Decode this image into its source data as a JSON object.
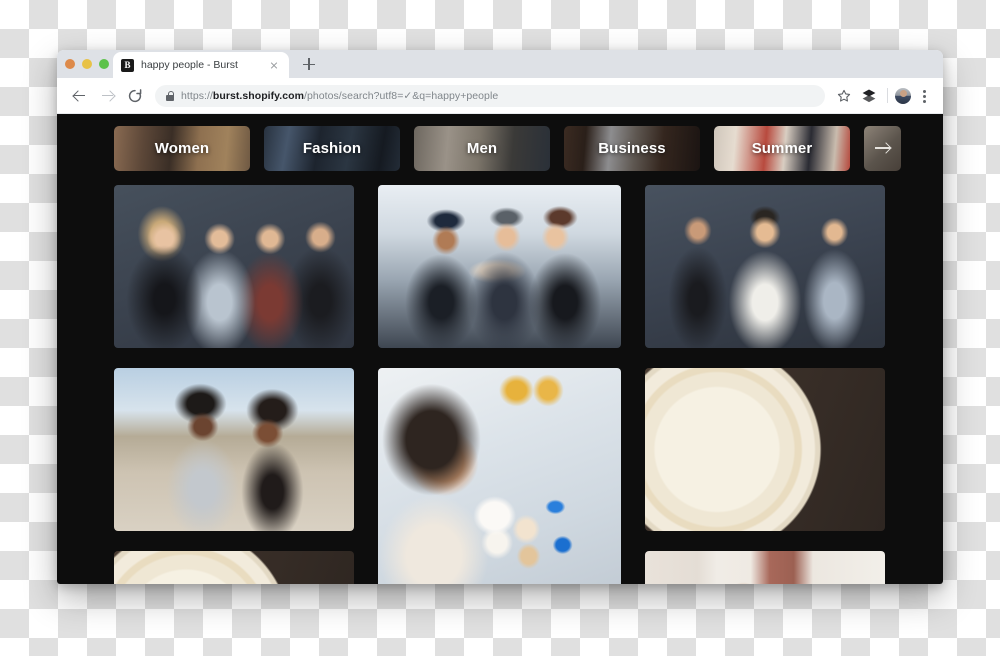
{
  "browser": {
    "window_controls": [
      "close",
      "minimize",
      "maximize"
    ],
    "tab": {
      "title": "happy people - Burst",
      "favicon_letter": "B",
      "close_label": "×"
    },
    "new_tab_label": "+",
    "nav": {
      "back_icon": "back-arrow-icon",
      "forward_icon": "forward-arrow-icon",
      "reload_icon": "reload-icon"
    },
    "address_bar": {
      "lock_icon": "lock-icon",
      "scheme": "https://",
      "domain": "burst.shopify.com",
      "path": "/photos/search?utf8=✓&q=happy+people",
      "full_url": "https://burst.shopify.com/photos/search?utf8=✓&q=happy+people"
    },
    "toolbar_right": {
      "bookmark_icon": "star-icon",
      "extensions_icon": "extensions-icon",
      "profile_icon": "avatar-icon",
      "menu_icon": "kebab-menu-icon"
    }
  },
  "page": {
    "background_color": "#0d0d0d",
    "categories": [
      {
        "label": "Women",
        "thumb": "ph-women"
      },
      {
        "label": "Fashion",
        "thumb": "ph-fashion"
      },
      {
        "label": "Men",
        "thumb": "ph-men2"
      },
      {
        "label": "Business",
        "thumb": "ph-business"
      },
      {
        "label": "Summer",
        "thumb": "ph-summer"
      }
    ],
    "categories_next_label": "next-arrow-icon",
    "photos": {
      "column_1": [
        {
          "alt": "Four friends standing arm in arm against dark studio backdrop",
          "thumb": "ph-group4",
          "size": "standard"
        },
        {
          "alt": "Two women laughing together on a beach",
          "thumb": "ph-beach",
          "size": "standard"
        },
        {
          "alt": "Birthday cake with sprinkles on dark wood table",
          "thumb": "ph-cake2",
          "size": "cropped"
        }
      ],
      "column_2": [
        {
          "alt": "Three friends taking a selfie with a tablet in winter coats",
          "thumb": "ph-selfie",
          "size": "standard"
        },
        {
          "alt": "Woman laughing while holding two soft serve ice cream cones",
          "thumb": "ph-icecream",
          "size": "tall"
        }
      ],
      "column_3": [
        {
          "alt": "Three friends laughing against dark studio backdrop",
          "thumb": "ph-group3",
          "size": "standard"
        },
        {
          "alt": "Happy Birthday cake with gold lettering on dark wood",
          "thumb": "ph-cake",
          "size": "standard"
        },
        {
          "alt": "Young girl dancing by a window with brick wall",
          "thumb": "ph-girl",
          "size": "cropped"
        }
      ]
    }
  }
}
